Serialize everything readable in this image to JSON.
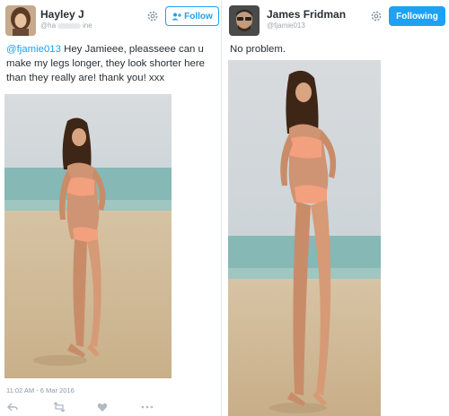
{
  "left_tweet": {
    "display_name": "Hayley J",
    "handle_prefix": "@ha",
    "handle_suffix": "ine",
    "follow_label": "Follow",
    "mention": "@fjamie013",
    "text": " Hey Jamieee, pleasseee can u make my legs longer, they look shorter here than they really are! thank you! xxx",
    "timestamp": "11:02 AM - 6 Mar 2016",
    "actions": [
      "reply-icon",
      "retweet-icon",
      "like-icon",
      "more-icon"
    ]
  },
  "right_tweet": {
    "display_name": "James Fridman",
    "handle": "@fjamie013",
    "follow_label": "Following",
    "text": "No problem."
  },
  "colors": {
    "accent": "#1da1f2",
    "text": "#292f33",
    "muted": "#8899a6"
  }
}
